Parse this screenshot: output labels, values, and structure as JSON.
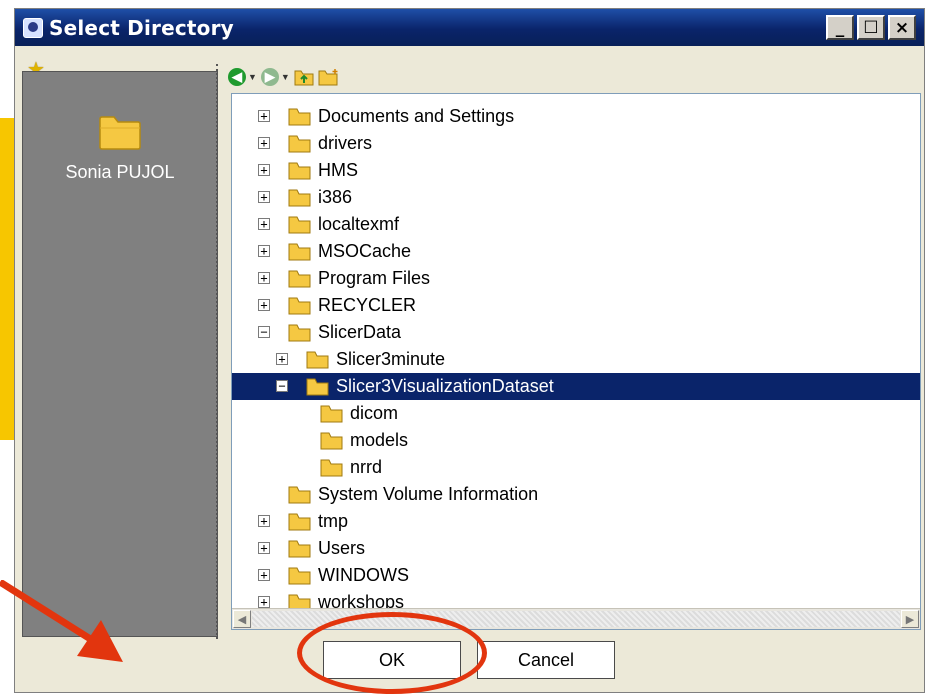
{
  "window": {
    "title": "Select Directory",
    "buttons": {
      "minimize": "_",
      "maximize": "☐",
      "close": "×"
    }
  },
  "sidebar": {
    "favorite_label": "Sonia PUJOL"
  },
  "tree": {
    "items": [
      {
        "label": "Documents and Settings",
        "expander": "+"
      },
      {
        "label": "drivers",
        "expander": "+"
      },
      {
        "label": "HMS",
        "expander": "+"
      },
      {
        "label": "i386",
        "expander": "+"
      },
      {
        "label": "localtexmf",
        "expander": "+"
      },
      {
        "label": "MSOCache",
        "expander": "+"
      },
      {
        "label": "Program Files",
        "expander": "+"
      },
      {
        "label": "RECYCLER",
        "expander": "+"
      },
      {
        "label": "SlicerData",
        "expander": "−"
      },
      {
        "label": "Slicer3minute",
        "expander": "+"
      },
      {
        "label": "Slicer3VisualizationDataset",
        "expander": "−",
        "selected": true
      },
      {
        "label": "dicom",
        "expander": ""
      },
      {
        "label": "models",
        "expander": ""
      },
      {
        "label": "nrrd",
        "expander": ""
      },
      {
        "label": "System Volume Information",
        "expander": ""
      },
      {
        "label": "tmp",
        "expander": "+"
      },
      {
        "label": "Users",
        "expander": "+"
      },
      {
        "label": "WINDOWS",
        "expander": "+"
      },
      {
        "label": "workshops",
        "expander": "+"
      }
    ]
  },
  "footer": {
    "ok_label": "OK",
    "cancel_label": "Cancel"
  },
  "colors": {
    "title_bar": "#0a246a",
    "selection": "#0a246a",
    "annotation": "#e2350e",
    "folder": "#f5c842"
  }
}
